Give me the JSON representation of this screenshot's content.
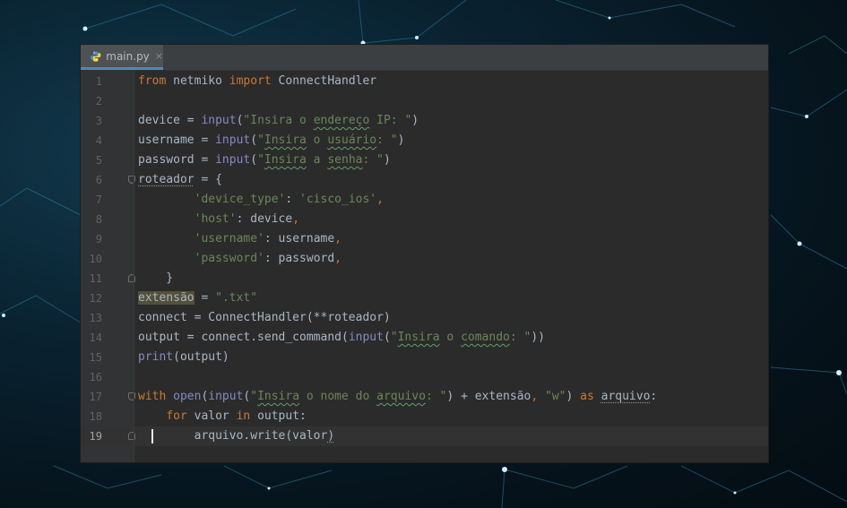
{
  "tab": {
    "filename": "main.py",
    "close_glyph": "×",
    "icon": "python-file-icon"
  },
  "colors": {
    "keyword": "#cc7832",
    "string": "#6a8759",
    "builtin": "#8888c6",
    "plain": "#a9b7c6",
    "line_number": "#606366",
    "editor_bg": "#2b2b2b"
  },
  "editor": {
    "current_line": 19,
    "lines": [
      {
        "n": "1",
        "tokens": [
          [
            "kw",
            "from"
          ],
          [
            "pl",
            " netmiko "
          ],
          [
            "kw",
            "import"
          ],
          [
            "pl",
            " ConnectHandler"
          ]
        ]
      },
      {
        "n": "2",
        "tokens": []
      },
      {
        "n": "3",
        "tokens": [
          [
            "pl",
            "device = "
          ],
          [
            "bi",
            "input"
          ],
          [
            "pl",
            "("
          ],
          [
            "str",
            "\"Insira o "
          ],
          [
            "str typo",
            "endereço"
          ],
          [
            "str",
            " IP: \""
          ],
          [
            "pl",
            ")"
          ]
        ]
      },
      {
        "n": "4",
        "tokens": [
          [
            "pl",
            "username = "
          ],
          [
            "bi",
            "input"
          ],
          [
            "pl",
            "("
          ],
          [
            "str",
            "\""
          ],
          [
            "str typo",
            "Insira"
          ],
          [
            "str",
            " o "
          ],
          [
            "str typo",
            "usuário"
          ],
          [
            "str",
            ": \""
          ],
          [
            "pl",
            ")"
          ]
        ]
      },
      {
        "n": "5",
        "tokens": [
          [
            "pl",
            "password = "
          ],
          [
            "bi",
            "input"
          ],
          [
            "pl",
            "("
          ],
          [
            "str",
            "\""
          ],
          [
            "str typo",
            "Insira"
          ],
          [
            "str",
            " a "
          ],
          [
            "str typo",
            "senha"
          ],
          [
            "str",
            ": \""
          ],
          [
            "pl",
            ")"
          ]
        ]
      },
      {
        "n": "6",
        "fold": "down",
        "tokens": [
          [
            "pl dotted",
            "roteador"
          ],
          [
            "pl",
            " = {"
          ]
        ]
      },
      {
        "n": "7",
        "tokens": [
          [
            "pl",
            "        "
          ],
          [
            "str",
            "'device_type'"
          ],
          [
            "pl",
            ": "
          ],
          [
            "str",
            "'cisco_ios'"
          ],
          [
            "kw",
            ","
          ]
        ]
      },
      {
        "n": "8",
        "tokens": [
          [
            "pl",
            "        "
          ],
          [
            "str",
            "'host'"
          ],
          [
            "pl",
            ": device"
          ],
          [
            "kw",
            ","
          ]
        ]
      },
      {
        "n": "9",
        "tokens": [
          [
            "pl",
            "        "
          ],
          [
            "str",
            "'username'"
          ],
          [
            "pl",
            ": username"
          ],
          [
            "kw",
            ","
          ]
        ]
      },
      {
        "n": "10",
        "tokens": [
          [
            "pl",
            "        "
          ],
          [
            "str",
            "'password'"
          ],
          [
            "pl",
            ": password"
          ],
          [
            "kw",
            ","
          ]
        ]
      },
      {
        "n": "11",
        "fold": "up",
        "tokens": [
          [
            "pl",
            "    }"
          ]
        ]
      },
      {
        "n": "12",
        "tokens": [
          [
            "pl hl",
            "extensão"
          ],
          [
            "pl",
            " = "
          ],
          [
            "str",
            "\".txt\""
          ]
        ]
      },
      {
        "n": "13",
        "tokens": [
          [
            "pl",
            "connect = ConnectHandler(**roteador)"
          ]
        ]
      },
      {
        "n": "14",
        "tokens": [
          [
            "pl",
            "output = connect.send_command("
          ],
          [
            "bi",
            "input"
          ],
          [
            "pl",
            "("
          ],
          [
            "str",
            "\""
          ],
          [
            "str typo",
            "Insira"
          ],
          [
            "str",
            " o "
          ],
          [
            "str typo",
            "comando"
          ],
          [
            "str",
            ": \""
          ],
          [
            "pl",
            "))"
          ]
        ]
      },
      {
        "n": "15",
        "tokens": [
          [
            "bi",
            "print"
          ],
          [
            "pl",
            "(output)"
          ]
        ]
      },
      {
        "n": "16",
        "tokens": []
      },
      {
        "n": "17",
        "fold": "down",
        "tokens": [
          [
            "kw",
            "with "
          ],
          [
            "bi",
            "open"
          ],
          [
            "pl",
            "("
          ],
          [
            "bi",
            "input"
          ],
          [
            "pl",
            "("
          ],
          [
            "str",
            "\""
          ],
          [
            "str typo",
            "Insira"
          ],
          [
            "str",
            " o nome do "
          ],
          [
            "str typo",
            "arquivo"
          ],
          [
            "str",
            ": \""
          ],
          [
            "pl",
            ") + extensão"
          ],
          [
            "kw",
            ","
          ],
          [
            "pl",
            " "
          ],
          [
            "str",
            "\"w\""
          ],
          [
            "pl",
            ") "
          ],
          [
            "kw",
            "as "
          ],
          [
            "pl dotted",
            "arquivo"
          ],
          [
            "pl",
            ":"
          ]
        ]
      },
      {
        "n": "18",
        "tokens": [
          [
            "pl",
            "    "
          ],
          [
            "kw",
            "for"
          ],
          [
            "pl",
            " valor "
          ],
          [
            "kw",
            "in"
          ],
          [
            "pl",
            " output:"
          ]
        ]
      },
      {
        "n": "19",
        "fold": "up",
        "caret": true,
        "tokens": [
          [
            "pl",
            "        arquivo.write(valor"
          ],
          [
            "pl dotted",
            ")"
          ]
        ]
      }
    ]
  }
}
